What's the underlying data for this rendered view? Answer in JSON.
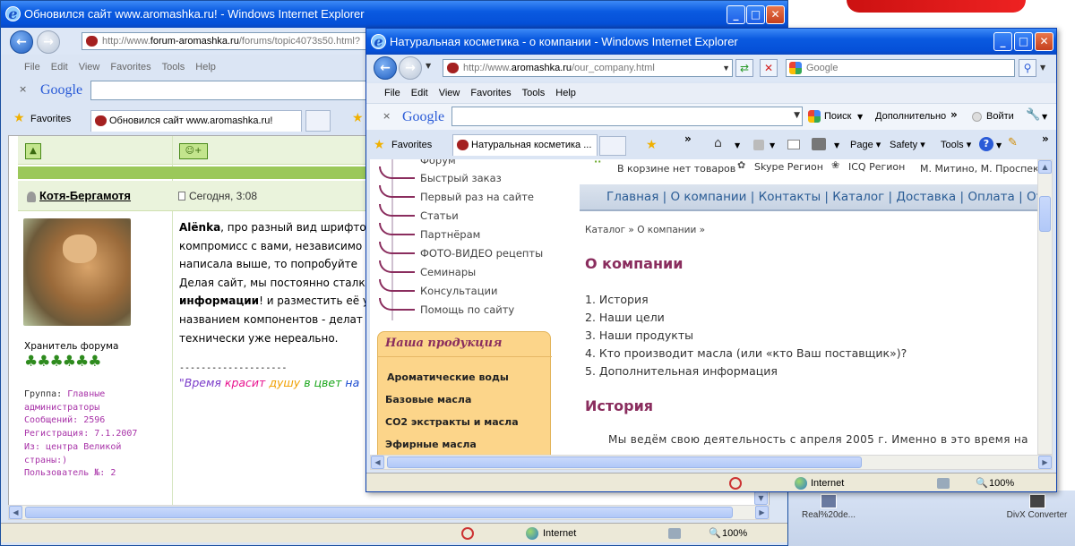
{
  "desktop": {
    "icon1_label": "Real%20de...",
    "icon2_label": "DivX Converter"
  },
  "back_window": {
    "title": "Обновился сайт www.aromashka.ru! - Windows Internet Explorer",
    "address_prefix": "http://www.",
    "address_domain": "forum-aromashka.ru",
    "address_suffix": "/forums/topic4073s50.html?",
    "menu": [
      "File",
      "Edit",
      "View",
      "Favorites",
      "Tools",
      "Help"
    ],
    "google_label": "Google",
    "favorites_label": "Favorites",
    "tab_label": "Обновился сайт www.aromashka.ru!",
    "post": {
      "author": "Котя-Бергамотя",
      "date": "Сегодня, 3:08",
      "rank": "Хранитель форума",
      "stars": "♣♣♣♣♣♣",
      "group_label": "Группа:",
      "group_value": "Главные администраторы",
      "messages": "Сообщений: 2596",
      "registration": "Регистрация: 7.1.2007",
      "from": "Из: центра Великой страны:)",
      "user_no": "Пользователь №: 2",
      "text_author": "Alёnka",
      "text_1": ", про разный вид шрифто",
      "text_2": "компромисс с вами, независимо о",
      "text_3": "написала выше, то попробуйте",
      "text_4": "Делая сайт, мы постоянно сталк",
      "text_5_bold": "информации",
      "text_5": "! и разместить её у",
      "text_6": "названием компонентов - делат",
      "text_7": "технически уже нереально.",
      "sig_sep": "--------------------",
      "sig_q": "\"",
      "sig_w1": "Время",
      "sig_w2": "красит",
      "sig_w3": "душу",
      "sig_w4": "в",
      "sig_w5": "цвет",
      "sig_w6": "на"
    },
    "status_zone": "Internet",
    "status_zoom": "100%"
  },
  "front_window": {
    "title": "Натуральная косметика - о компании - Windows Internet Explorer",
    "address_prefix": "http://www.",
    "address_domain": "aromashka.ru",
    "address_suffix": "/our_company.html",
    "search_placeholder": "Google",
    "menu": [
      "File",
      "Edit",
      "View",
      "Favorites",
      "Tools",
      "Help"
    ],
    "google_label": "Google",
    "gbar_search": "Поиск",
    "gbar_more": "Дополнительно",
    "gbar_login": "Войти",
    "favorites_label": "Favorites",
    "tab_label": "Натуральная косметика ...",
    "cmd_page": "Page",
    "cmd_safety": "Safety",
    "cmd_tools": "Tools",
    "page": {
      "top_cart": "В корзине нет товаров",
      "top_skype": "Skype Регион",
      "top_icq": "ICQ Регион",
      "top_address": "М. Митино, М. Проспек",
      "nav": [
        "Главная",
        "О компании",
        "Контакты",
        "Каталог",
        "Доставка",
        "Оплата",
        "Отзы"
      ],
      "nav_sep": "|",
      "breadcrumb": "Каталог » О компании »",
      "heading": "О компании",
      "toc": [
        "1. История",
        "2. Наши цели",
        "3. Наши продукты",
        "4. Кто производит масла (или «кто Ваш поставщик»)?",
        "5. Дополнительная информация"
      ],
      "history_heading": "История",
      "history_text": "Мы ведём свою деятельность с апреля 2005 г. Именно в это время на",
      "left_menu_top": "Форум",
      "left_menu": [
        "Быстрый заказ",
        "Первый раз на сайте",
        "Статьи",
        "Партнёрам",
        "ФОТО-ВИДЕО рецепты",
        "Семинары",
        "Консультации",
        "Помощь по сайту"
      ],
      "products_title": "Наша продукция",
      "products": [
        "Ароматические воды",
        "Базовые масла",
        "СО2 экстракты и масла",
        "Эфирные масла"
      ]
    },
    "status_zone": "Internet",
    "status_zoom": "100%"
  },
  "colors": {
    "title_blue": "#0a5ae0",
    "forum_green": "#9bc85a",
    "site_purple": "#8a2d5e",
    "nav_blue": "#2a5c95",
    "products_orange": "#fcd58a"
  }
}
